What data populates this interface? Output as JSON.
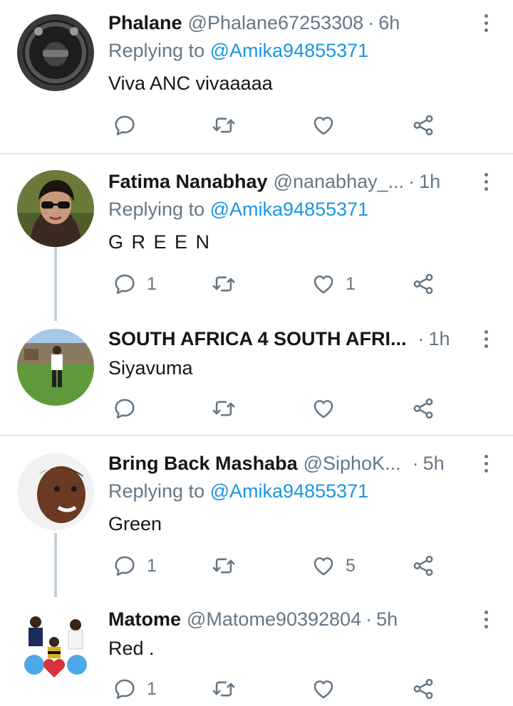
{
  "tweets": [
    {
      "name": "Phalane",
      "handle": "@Phalane67253308",
      "time": "6h",
      "replying_label": "Replying to",
      "replying_to": "@Amika94855371",
      "text": "Viva ANC vivaaaaa",
      "reply_count": "",
      "like_count": ""
    },
    {
      "name": "Fatima Nanabhay",
      "handle": "@nanabhay_...",
      "time": "1h",
      "replying_label": "Replying to",
      "replying_to": "@Amika94855371",
      "text": "G R E E N",
      "reply_count": "1",
      "like_count": "1"
    },
    {
      "name": "SOUTH AFRICA 4 SOUTH AFRI...",
      "handle": "",
      "time": "1h",
      "text": "Siyavuma",
      "reply_count": "",
      "like_count": ""
    },
    {
      "name": "Bring Back Mashaba",
      "handle": "@SiphoK...",
      "time": "5h",
      "replying_label": "Replying to",
      "replying_to": "@Amika94855371",
      "text": "Green",
      "reply_count": "1",
      "like_count": "5"
    },
    {
      "name": "Matome",
      "handle": "@Matome90392804",
      "time": "5h",
      "text": "Red .",
      "reply_count": "1",
      "like_count": ""
    }
  ],
  "dot_separator": "·",
  "colors": {
    "accent": "#1b95e0",
    "secondary_text": "#657786",
    "divider": "#e1e8ed",
    "thread_line": "#c4cfd6"
  },
  "icons": [
    "reply-icon",
    "retweet-icon",
    "like-icon",
    "share-icon",
    "more-icon"
  ]
}
